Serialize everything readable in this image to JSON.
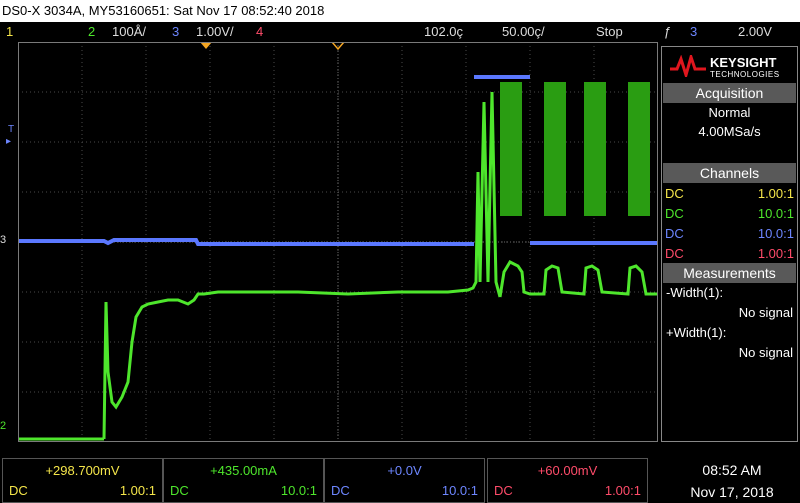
{
  "title": "DS0-X 3034A, MY53160651: Sat Nov 17 08:52:40 2018",
  "status": {
    "ch1_num": "1",
    "ch2_num": "2",
    "ch2_scale": "100Å/",
    "ch3_num": "3",
    "ch3_scale": "1.00V/",
    "ch4_num": "4",
    "time_pos": "102.0ç",
    "time_scale": "50.00ç/",
    "run_state": "Stop",
    "trig_icon": "ƒ",
    "trig_ch": "3",
    "trig_level": "2.00V"
  },
  "markers": {
    "t": "T",
    "ch3": "3",
    "ch2": "2"
  },
  "logo": {
    "line1": "KEYSIGHT",
    "line2": "TECHNOLOGIES"
  },
  "acquisition": {
    "header": "Acquisition",
    "mode": "Normal",
    "rate": "4.00MSa/s"
  },
  "channels": {
    "header": "Channels",
    "rows": [
      {
        "coupling": "DC",
        "probe": "1.00:1",
        "color": "#f5e64a"
      },
      {
        "coupling": "DC",
        "probe": "10.0:1",
        "color": "#4ee62c"
      },
      {
        "coupling": "DC",
        "probe": "10.0:1",
        "color": "#6d86ff"
      },
      {
        "coupling": "DC",
        "probe": "1.00:1",
        "color": "#ff4c6a"
      }
    ]
  },
  "measurements": {
    "header": "Measurements",
    "items": [
      {
        "label": "-Width(1):",
        "value": "No signal"
      },
      {
        "label": "+Width(1):",
        "value": "No signal"
      }
    ]
  },
  "bottom": [
    {
      "value": "+298.700mV",
      "coupling": "DC",
      "probe": "1.00:1",
      "color": "#f5e64a"
    },
    {
      "value": "+435.00mA",
      "coupling": "DC",
      "probe": "10.0:1",
      "color": "#4ee62c"
    },
    {
      "value": "+0.0V",
      "coupling": "DC",
      "probe": "10.0:1",
      "color": "#6d86ff"
    },
    {
      "value": "+60.00mV",
      "coupling": "DC",
      "probe": "1.00:1",
      "color": "#ff4c6a"
    }
  ],
  "clock": {
    "time": "08:52 AM",
    "date": "Nov 17, 2018"
  },
  "colors": {
    "ch1": "#f5e64a",
    "ch2": "#4ee62c",
    "ch3": "#6d86ff",
    "ch4": "#ff4c6a",
    "trigger_marker": "#f5a623"
  }
}
